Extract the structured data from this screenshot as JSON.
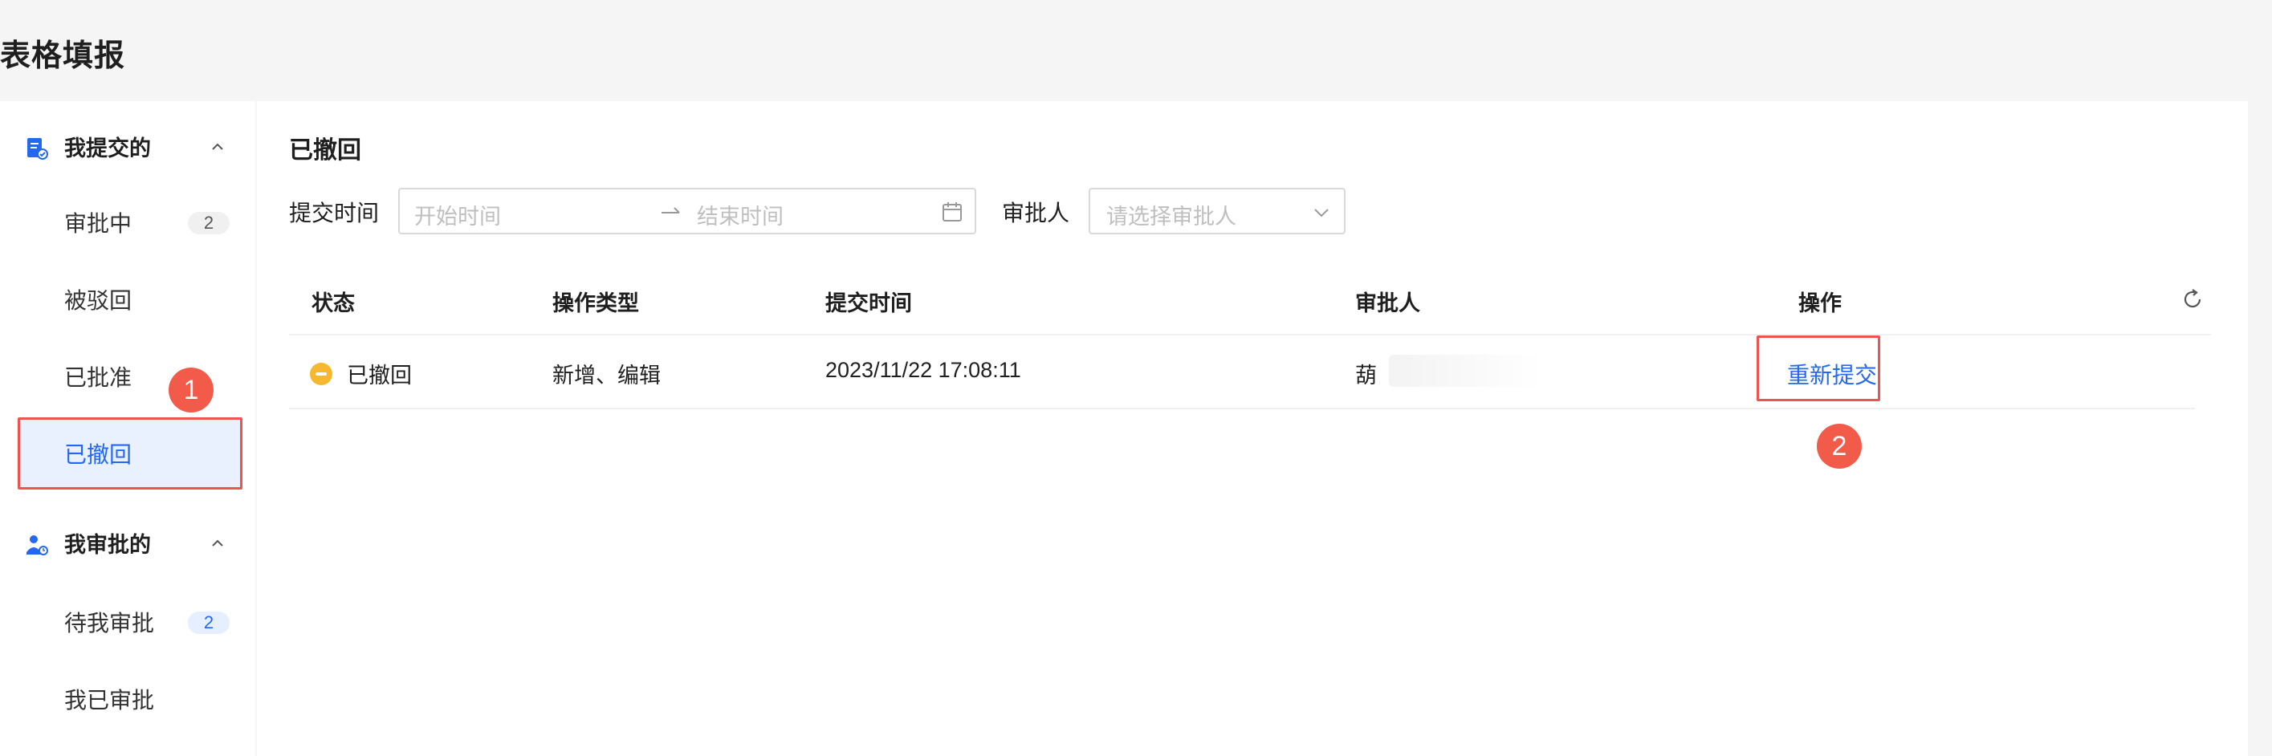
{
  "page": {
    "title": "表格填报"
  },
  "sidebar": {
    "groups": [
      {
        "label": "我提交的",
        "icon": "document-submit-icon",
        "items": [
          {
            "label": "审批中",
            "badge": "2"
          },
          {
            "label": "被驳回"
          },
          {
            "label": "已批准"
          },
          {
            "label": "已撤回",
            "active": true
          }
        ]
      },
      {
        "label": "我审批的",
        "icon": "approver-user-icon",
        "items": [
          {
            "label": "待我审批",
            "badge": "2"
          },
          {
            "label": "我已审批"
          }
        ]
      }
    ]
  },
  "main": {
    "title": "已撤回",
    "filters": {
      "submit_time_label": "提交时间",
      "start_placeholder": "开始时间",
      "end_placeholder": "结束时间",
      "approver_label": "审批人",
      "approver_placeholder": "请选择审批人"
    },
    "table": {
      "columns": [
        "状态",
        "操作类型",
        "提交时间",
        "审批人",
        "操作"
      ],
      "rows": [
        {
          "status": "已撤回",
          "op_type": "新增、编辑",
          "submit_time": "2023/11/22 17:08:11",
          "approver": "葫",
          "action": "重新提交"
        }
      ]
    }
  },
  "annotations": {
    "marker_1": "1",
    "marker_2": "2"
  },
  "colors": {
    "accent": "#2468f2",
    "highlight": "#ef5350",
    "status_withdrawn": "#f5b82e"
  }
}
